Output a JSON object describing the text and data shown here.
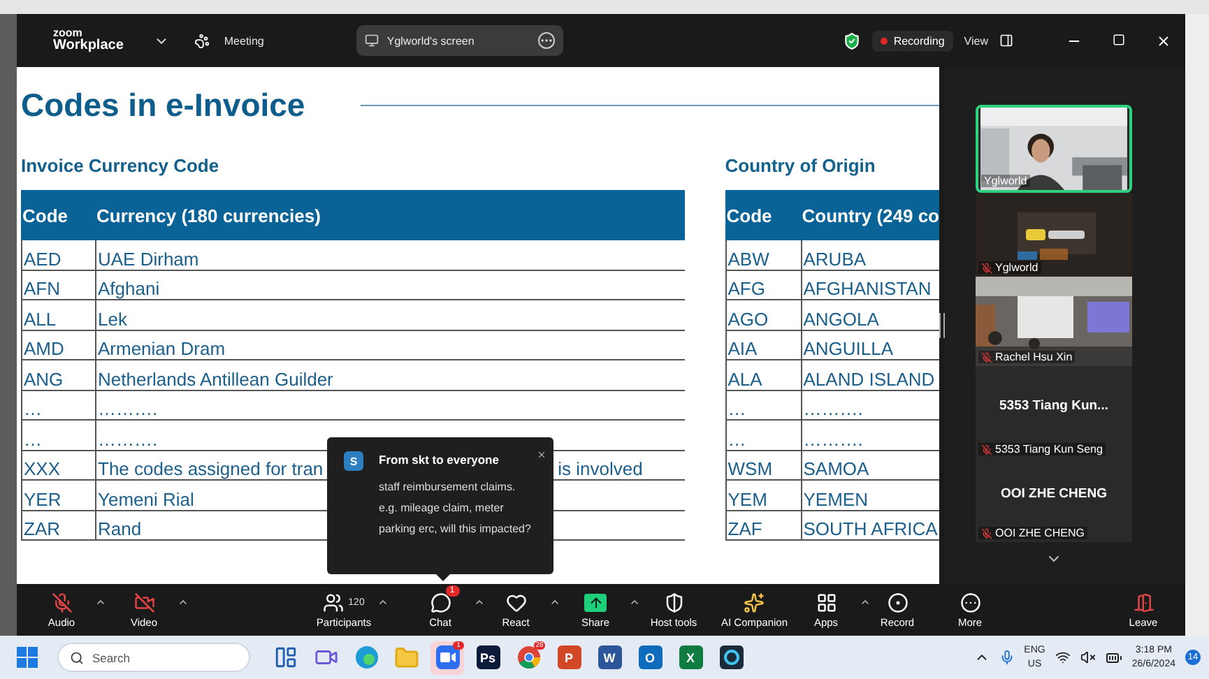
{
  "window": {
    "brand": "zoom",
    "app_name": "Workplace",
    "meeting_label": "Meeting",
    "share_label": "Yglworld's screen",
    "recording": "Recording",
    "view": "View"
  },
  "slide": {
    "title": "Codes in e-Invoice",
    "tables": [
      {
        "heading": "Invoice Currency Code",
        "columns": [
          "Code",
          "Currency (180 currencies)"
        ],
        "rows": [
          {
            "cells": [
              [
                "AED"
              ],
              [
                "UAE Dirham"
              ]
            ]
          },
          {
            "cells": [
              [
                "AFN"
              ],
              [
                "Afghani"
              ]
            ]
          },
          {
            "cells": [
              [
                "ALL"
              ],
              [
                "Lek"
              ]
            ]
          },
          {
            "cells": [
              [
                "AMD"
              ],
              [
                "Armenian Dram"
              ]
            ]
          },
          {
            "cells": [
              [
                "ANG"
              ],
              [
                "Netherlands Antillean Guilder"
              ]
            ]
          },
          {
            "cells": [
              [
                "…"
              ],
              [
                "………."
              ]
            ]
          },
          {
            "cells": [
              [
                "…"
              ],
              [
                "………."
              ]
            ]
          },
          {
            "cells": [
              [
                "XXX"
              ],
              [
                "The codes assigned for tran",
                "is involved"
              ]
            ]
          },
          {
            "cells": [
              [
                "YER"
              ],
              [
                "Yemeni Rial"
              ]
            ]
          },
          {
            "cells": [
              [
                "ZAR"
              ],
              [
                "Rand"
              ]
            ]
          }
        ]
      },
      {
        "heading": "Country of Origin",
        "columns": [
          "Code",
          "Country (249 co"
        ],
        "rows": [
          {
            "cells": [
              [
                "ABW"
              ],
              [
                "ARUBA"
              ]
            ]
          },
          {
            "cells": [
              [
                "AFG"
              ],
              [
                "AFGHANISTAN"
              ]
            ]
          },
          {
            "cells": [
              [
                "AGO"
              ],
              [
                "ANGOLA"
              ]
            ]
          },
          {
            "cells": [
              [
                "AIA"
              ],
              [
                "ANGUILLA"
              ]
            ]
          },
          {
            "cells": [
              [
                "ALA"
              ],
              [
                "ALAND ISLAND"
              ]
            ]
          },
          {
            "cells": [
              [
                "…"
              ],
              [
                "………."
              ]
            ]
          },
          {
            "cells": [
              [
                "…"
              ],
              [
                "………."
              ]
            ]
          },
          {
            "cells": [
              [
                "WSM"
              ],
              [
                "SAMOA"
              ]
            ]
          },
          {
            "cells": [
              [
                "YEM"
              ],
              [
                "YEMEN"
              ]
            ]
          },
          {
            "cells": [
              [
                "ZAF"
              ],
              [
                "SOUTH AFRICA"
              ]
            ]
          }
        ]
      }
    ]
  },
  "chat_popup": {
    "avatar": "S",
    "title": "From skt to everyone",
    "message": "staff reimbursement claims. e.g. mileage claim, meter parking erc, will this impacted?"
  },
  "participants": [
    {
      "kind": "video",
      "name": "Yglworld",
      "muted": false,
      "active": true
    },
    {
      "kind": "video",
      "name": "Yglworld",
      "muted": true,
      "active": false
    },
    {
      "kind": "video",
      "name": "Rachel Hsu Xin",
      "muted": true,
      "active": false
    },
    {
      "kind": "avatar",
      "display": "5353 Tiang Kun...",
      "name": "5353 Tiang Kun Seng",
      "muted": true,
      "active": false
    },
    {
      "kind": "avatar",
      "display": "OOI ZHE CHENG",
      "name": "OOI ZHE CHENG",
      "muted": true,
      "active": false
    }
  ],
  "toolbar": [
    {
      "kind": "audio",
      "label": "Audio",
      "off": true,
      "caret": true
    },
    {
      "kind": "video",
      "label": "Video",
      "off": true,
      "caret": true
    },
    {
      "kind": "participants",
      "label": "Participants",
      "count": "120",
      "caret": true
    },
    {
      "kind": "chat",
      "label": "Chat",
      "badge": "1",
      "caret": true
    },
    {
      "kind": "react",
      "label": "React",
      "caret": true
    },
    {
      "kind": "share",
      "label": "Share",
      "caret": true
    },
    {
      "kind": "host",
      "label": "Host tools",
      "caret": false
    },
    {
      "kind": "ai",
      "label": "AI Companion",
      "caret": false
    },
    {
      "kind": "apps",
      "label": "Apps",
      "caret": true
    },
    {
      "kind": "record",
      "label": "Record",
      "caret": false
    },
    {
      "kind": "more",
      "label": "More",
      "caret": false
    }
  ],
  "leave": {
    "label": "Leave"
  },
  "taskbar": {
    "search_placeholder": "Search",
    "apps": [
      {
        "kind": "widgets",
        "selected": false
      },
      {
        "kind": "meet",
        "selected": false
      },
      {
        "kind": "edge",
        "selected": false
      },
      {
        "kind": "files",
        "selected": false
      },
      {
        "kind": "zoom",
        "badge": "1",
        "selected": true
      },
      {
        "kind": "letter",
        "glyph": "Ps",
        "color": "#0c1b3a",
        "selected": false
      },
      {
        "kind": "chrome",
        "badge": "28",
        "selected": false
      },
      {
        "kind": "letter",
        "glyph": "P",
        "color": "#d24726",
        "selected": false
      },
      {
        "kind": "letter",
        "glyph": "W",
        "color": "#2b579a",
        "selected": false
      },
      {
        "kind": "letter",
        "glyph": "O",
        "color": "#0f6cbd",
        "selected": false
      },
      {
        "kind": "letter",
        "glyph": "X",
        "color": "#107c41",
        "selected": false
      },
      {
        "kind": "capcut",
        "selected": false
      }
    ],
    "language": "ENG",
    "region": "US",
    "time": "3:18 PM",
    "date": "26/6/2024",
    "notifications": "14"
  }
}
